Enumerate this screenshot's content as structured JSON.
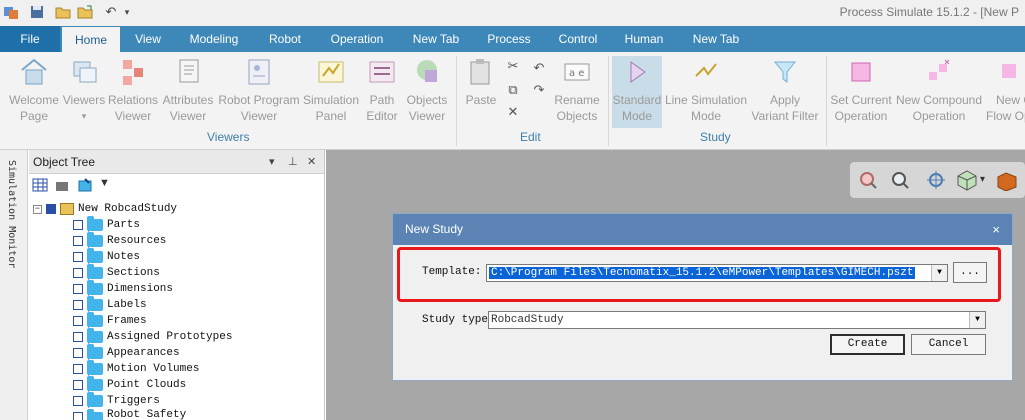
{
  "app_title": "Process Simulate 15.1.2 - [New P",
  "tabs": [
    "File",
    "Home",
    "View",
    "Modeling",
    "Robot",
    "Operation",
    "New Tab",
    "Process",
    "Control",
    "Human",
    "New Tab"
  ],
  "ribbon": {
    "viewers": {
      "group_label": "Viewers",
      "buttons": [
        {
          "label1": "Welcome",
          "label2": "Page"
        },
        {
          "label1": "Viewers",
          "label2": "▾"
        },
        {
          "label1": "Relations",
          "label2": "Viewer"
        },
        {
          "label1": "Attributes",
          "label2": "Viewer"
        },
        {
          "label1": "Robot Program",
          "label2": "Viewer"
        },
        {
          "label1": "Simulation",
          "label2": "Panel"
        },
        {
          "label1": "Path",
          "label2": "Editor"
        },
        {
          "label1": "Objects",
          "label2": "Viewer"
        }
      ]
    },
    "edit": {
      "group_label": "Edit",
      "paste": "Paste",
      "rename1": "Rename",
      "rename2": "Objects"
    },
    "study": {
      "group_label": "Study",
      "buttons": [
        {
          "label1": "Standard",
          "label2": "Mode"
        },
        {
          "label1": "Line Simulation",
          "label2": "Mode"
        },
        {
          "label1": "Apply",
          "label2": "Variant Filter"
        }
      ]
    },
    "operation": {
      "buttons": [
        {
          "label1": "Set Current",
          "label2": "Operation"
        },
        {
          "label1": "New Compound",
          "label2": "Operation"
        },
        {
          "label1": "New C",
          "label2": "Flow Op"
        }
      ]
    }
  },
  "side_strip": "Simulation Monitor",
  "object_tree": {
    "title": "Object Tree",
    "root": "New RobcadStudy",
    "items": [
      "Parts",
      "Resources",
      "Notes",
      "Sections",
      "Dimensions",
      "Labels",
      "Frames",
      "Assigned Prototypes",
      "Appearances",
      "Motion Volumes",
      "Point Clouds",
      "Triggers",
      "Robot Safety"
    ]
  },
  "dialog": {
    "title": "New Study",
    "close": "×",
    "template_label": "Template:",
    "template_value": "C:\\Program Files\\Tecnomatix_15.1.2\\eMPower\\Templates\\GIMECH.pszt",
    "browse": "...",
    "study_type_label": "Study type:",
    "study_type_value": "RobcadStudy",
    "create": "Create",
    "cancel": "Cancel"
  },
  "colors": {
    "tabbar": "#3d88b9",
    "dialog_title": "#5b84b5",
    "highlight": "#e8191c",
    "selection": "#0a64d8"
  }
}
